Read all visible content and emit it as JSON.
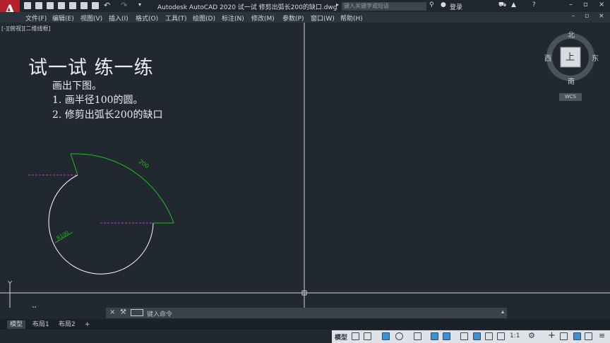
{
  "titlebar": {
    "app_title": "Autodesk AutoCAD 2020   试一试 修剪出弧长200的缺口.dwg",
    "search_placeholder": "键入关键字或短语",
    "signin_label": "登录"
  },
  "menu": {
    "items": [
      "文件(F)",
      "编辑(E)",
      "视图(V)",
      "插入(I)",
      "格式(O)",
      "工具(T)",
      "绘图(D)",
      "标注(N)",
      "修改(M)",
      "参数(P)",
      "窗口(W)",
      "帮助(H)"
    ]
  },
  "viewport": {
    "label": "[-][俯视][二维线框]"
  },
  "drawing": {
    "heading": "试一试  练一练",
    "lines": [
      "画出下图。",
      "1. 画半径100的圆。",
      "2. 修剪出弧长200的缺口"
    ],
    "arc_label": "200",
    "radius_label": "R100"
  },
  "viewcube": {
    "north": "北",
    "south": "南",
    "east": "东",
    "west": "西",
    "top": "上",
    "wcs": "WCS"
  },
  "ucs": {
    "x_label": "X",
    "y_label": "Y"
  },
  "command": {
    "placeholder": "键入命令"
  },
  "layout_tabs": {
    "items": [
      "模型",
      "布局1",
      "布局2"
    ],
    "add_label": "+"
  },
  "status_bar": {
    "model_label": "模型",
    "scale_label": "1:1"
  },
  "colors": {
    "background": "#212830",
    "geometry": "#ffffff",
    "dimension": "#19c219",
    "hidden_line": "#c33cc3",
    "accent_red": "#b5222b"
  }
}
